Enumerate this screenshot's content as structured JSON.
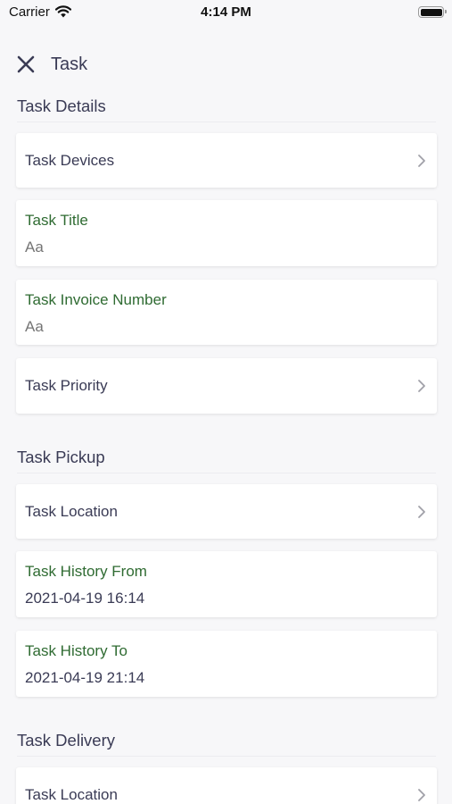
{
  "status_bar": {
    "carrier": "Carrier",
    "time": "4:14 PM"
  },
  "header": {
    "title": "Task",
    "close_icon": "close-icon"
  },
  "sections": {
    "details": {
      "title": "Task Details",
      "devices": {
        "label": "Task Devices"
      },
      "title_field": {
        "label": "Task Title",
        "placeholder": "Aa"
      },
      "invoice_field": {
        "label": "Task Invoice Number",
        "placeholder": "Aa"
      },
      "priority": {
        "label": "Task Priority"
      }
    },
    "pickup": {
      "title": "Task Pickup",
      "location": {
        "label": "Task Location"
      },
      "history_from": {
        "label": "Task History From",
        "value": "2021-04-19 16:14"
      },
      "history_to": {
        "label": "Task History To",
        "value": "2021-04-19 21:14"
      }
    },
    "delivery": {
      "title": "Task Delivery",
      "location": {
        "label": "Task Location"
      }
    }
  },
  "colors": {
    "accent_green": "#2f6b32",
    "text_dark": "#3a3b55",
    "placeholder": "#b3b3b9",
    "background": "#f7f7f9"
  }
}
